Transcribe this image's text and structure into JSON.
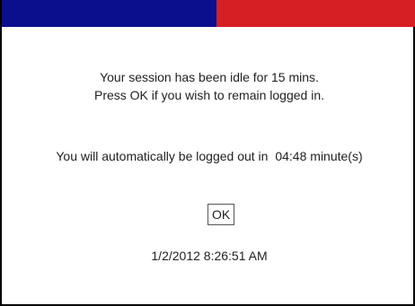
{
  "colors": {
    "bar_left": "#0b0f8d",
    "bar_right": "#d61f24"
  },
  "dialog": {
    "message_line1": "Your session has been idle for 15 mins.",
    "message_line2": "Press OK if you wish to remain logged in.",
    "countdown_prefix": "You will automatically be logged out in",
    "countdown_value": "04:48",
    "countdown_suffix": "minute(s)",
    "ok_label": "OK",
    "timestamp": "1/2/2012 8:26:51 AM"
  }
}
